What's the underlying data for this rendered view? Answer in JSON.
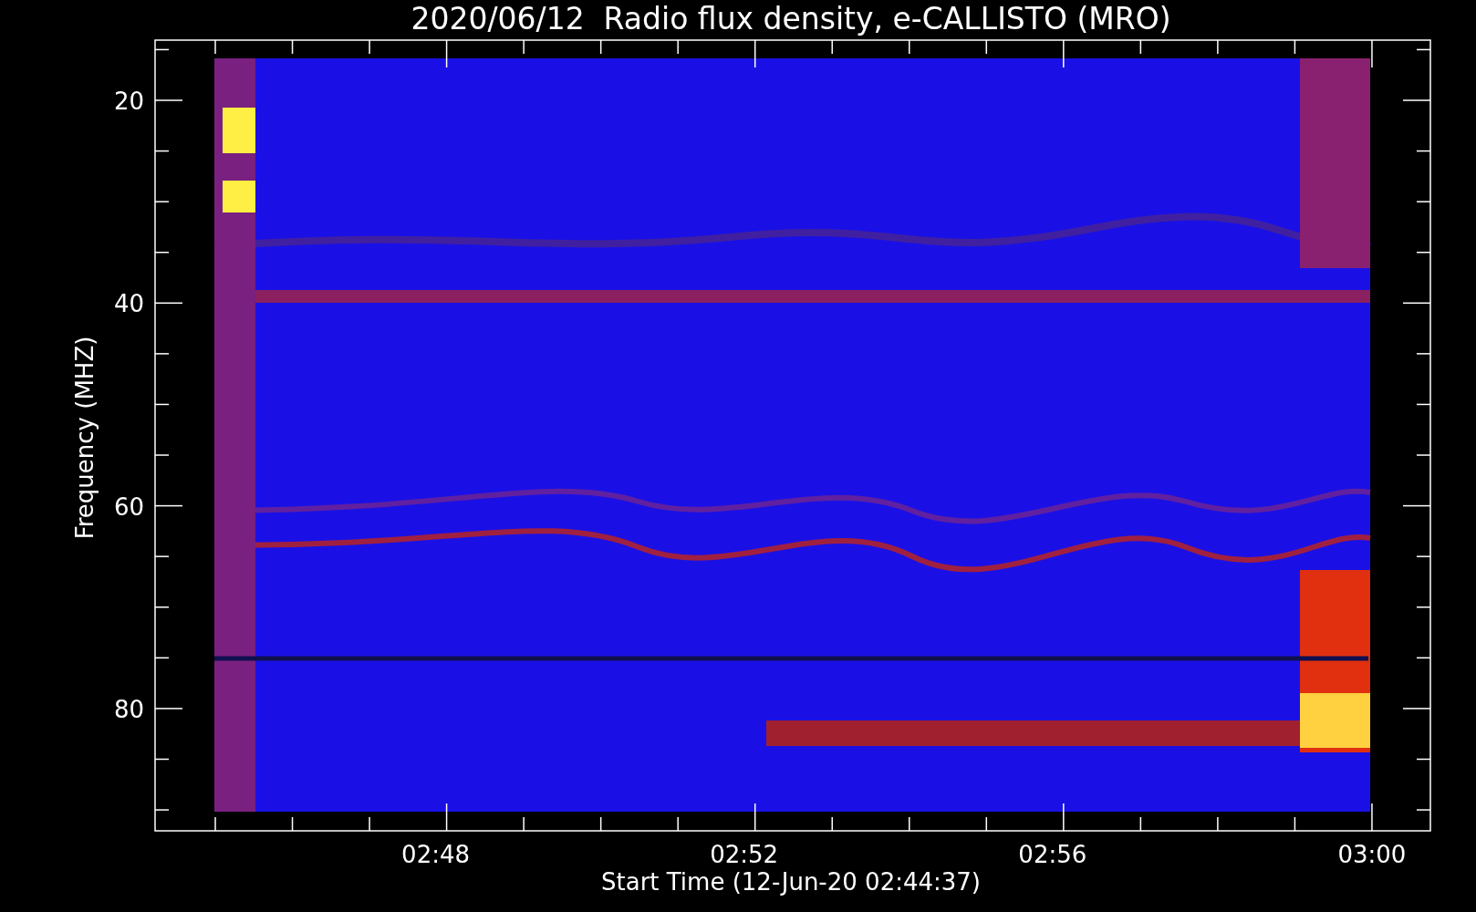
{
  "title": "2020/06/12  Radio flux density, e-CALLISTO (MRO)",
  "plot": {
    "ylabel": "Frequency (MHZ)",
    "xlabel": "Start Time (12-Jun-20 02:44:37)",
    "ytick_labels": [
      "20",
      "40",
      "60",
      "80"
    ],
    "xtick_labels": [
      "02:48",
      "02:52",
      "02:56",
      "03:00"
    ]
  }
}
